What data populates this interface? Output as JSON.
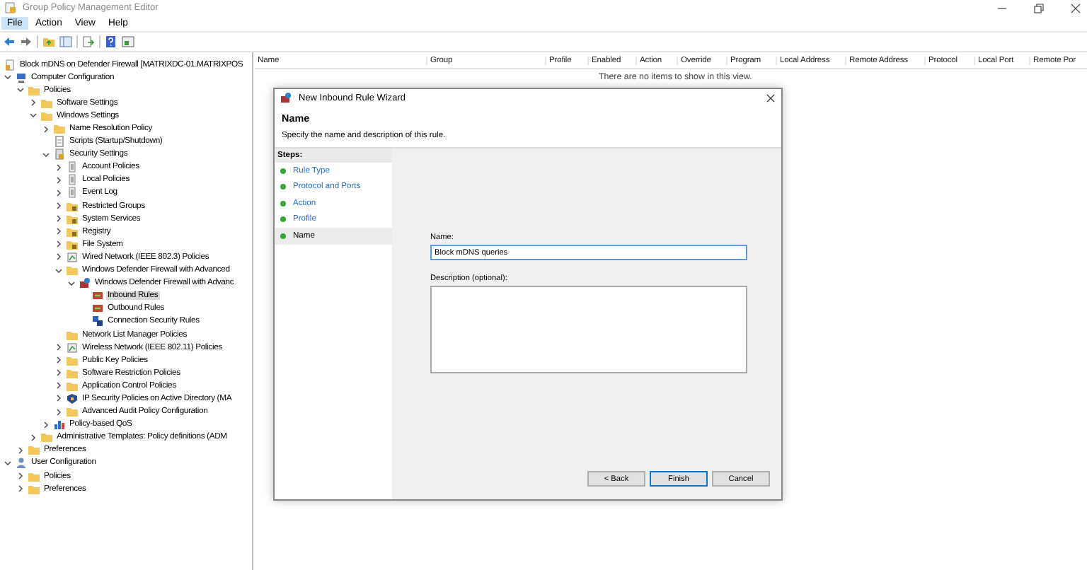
{
  "window": {
    "title": "Group Policy Management Editor"
  },
  "menu": [
    {
      "label": "File",
      "selected": true
    },
    {
      "label": "Action",
      "selected": false
    },
    {
      "label": "View",
      "selected": false
    },
    {
      "label": "Help",
      "selected": false
    }
  ],
  "tree": {
    "root": "Block mDNS on Defender Firewall [MATRIXDC-01.MATRIXPOS",
    "items": [
      {
        "label": "Computer Configuration",
        "kind": "computer",
        "expanded": true,
        "selected": false,
        "children": [
          {
            "label": "Policies",
            "kind": "folder",
            "expanded": true,
            "selected": false,
            "children": [
              {
                "label": "Software Settings",
                "kind": "folder",
                "expanded": false,
                "selected": false
              },
              {
                "label": "Windows Settings",
                "kind": "folder",
                "expanded": true,
                "selected": false,
                "children": [
                  {
                    "label": "Name Resolution Policy",
                    "kind": "folder",
                    "expanded": false,
                    "selected": false
                  },
                  {
                    "label": "Scripts (Startup/Shutdown)",
                    "kind": "script",
                    "selected": false
                  },
                  {
                    "label": "Security Settings",
                    "kind": "security",
                    "expanded": true,
                    "selected": false,
                    "children": [
                      {
                        "label": "Account Policies",
                        "kind": "policy",
                        "expanded": false,
                        "selected": false
                      },
                      {
                        "label": "Local Policies",
                        "kind": "policy",
                        "expanded": false,
                        "selected": false
                      },
                      {
                        "label": "Event Log",
                        "kind": "policy",
                        "expanded": false,
                        "selected": false
                      },
                      {
                        "label": "Restricted Groups",
                        "kind": "lockfolder",
                        "expanded": false,
                        "selected": false
                      },
                      {
                        "label": "System Services",
                        "kind": "lockfolder",
                        "expanded": false,
                        "selected": false
                      },
                      {
                        "label": "Registry",
                        "kind": "lockfolder",
                        "expanded": false,
                        "selected": false
                      },
                      {
                        "label": "File System",
                        "kind": "lockfolder",
                        "expanded": false,
                        "selected": false
                      },
                      {
                        "label": "Wired Network (IEEE 802.3) Policies",
                        "kind": "network",
                        "expanded": false,
                        "selected": false
                      },
                      {
                        "label": "Windows Defender Firewall with Advanced",
                        "kind": "folder",
                        "expanded": true,
                        "selected": false,
                        "children": [
                          {
                            "label": "Windows Defender Firewall with Advanc",
                            "kind": "firewall",
                            "expanded": true,
                            "selected": false,
                            "children": [
                              {
                                "label": "Inbound Rules",
                                "kind": "rule",
                                "selected": true
                              },
                              {
                                "label": "Outbound Rules",
                                "kind": "rule",
                                "selected": false
                              },
                              {
                                "label": "Connection Security Rules",
                                "kind": "connection",
                                "selected": false
                              }
                            ]
                          }
                        ]
                      },
                      {
                        "label": "Network List Manager Policies",
                        "kind": "folder",
                        "selected": false
                      },
                      {
                        "label": "Wireless Network (IEEE 802.11) Policies",
                        "kind": "network",
                        "expanded": false,
                        "selected": false
                      },
                      {
                        "label": "Public Key Policies",
                        "kind": "folder",
                        "expanded": false,
                        "selected": false
                      },
                      {
                        "label": "Software Restriction Policies",
                        "kind": "folder",
                        "expanded": false,
                        "selected": false
                      },
                      {
                        "label": "Application Control Policies",
                        "kind": "folder",
                        "expanded": false,
                        "selected": false
                      },
                      {
                        "label": "IP Security Policies on Active Directory (MA",
                        "kind": "ipsec",
                        "expanded": false,
                        "selected": false
                      },
                      {
                        "label": "Advanced Audit Policy Configuration",
                        "kind": "folder",
                        "expanded": false,
                        "selected": false
                      }
                    ]
                  },
                  {
                    "label": "Policy-based QoS",
                    "kind": "qos",
                    "expanded": false,
                    "selected": false
                  }
                ]
              },
              {
                "label": "Administrative Templates: Policy definitions (ADM",
                "kind": "folder",
                "expanded": false,
                "selected": false
              }
            ]
          },
          {
            "label": "Preferences",
            "kind": "folder",
            "expanded": false,
            "selected": false
          }
        ]
      },
      {
        "label": "User Configuration",
        "kind": "user",
        "expanded": true,
        "selected": false,
        "children": [
          {
            "label": "Policies",
            "kind": "folder",
            "expanded": false,
            "selected": false
          },
          {
            "label": "Preferences",
            "kind": "folder",
            "expanded": false,
            "selected": false
          }
        ]
      }
    ]
  },
  "list": {
    "columns": [
      "Name",
      "Group",
      "Profile",
      "Enabled",
      "Action",
      "Override",
      "Program",
      "Local Address",
      "Remote Address",
      "Protocol",
      "Local Port",
      "Remote Por"
    ],
    "empty_message": "There are no items to show in this view."
  },
  "dialog": {
    "title": "New Inbound Rule Wizard",
    "heading": "Name",
    "subtitle": "Specify the name and description of this rule.",
    "steps_label": "Steps:",
    "steps": [
      {
        "label": "Rule Type",
        "selected": false
      },
      {
        "label": "Protocol and Ports",
        "selected": false
      },
      {
        "label": "Action",
        "selected": false
      },
      {
        "label": "Profile",
        "selected": false
      },
      {
        "label": "Name",
        "selected": true
      }
    ],
    "name_label": "Name:",
    "name_value": "Block mDNS queries",
    "description_label": "Description (optional):",
    "buttons": [
      {
        "label": "< Back",
        "default": false
      },
      {
        "label": "Finish",
        "default": true
      },
      {
        "label": "Cancel",
        "default": false
      }
    ]
  }
}
